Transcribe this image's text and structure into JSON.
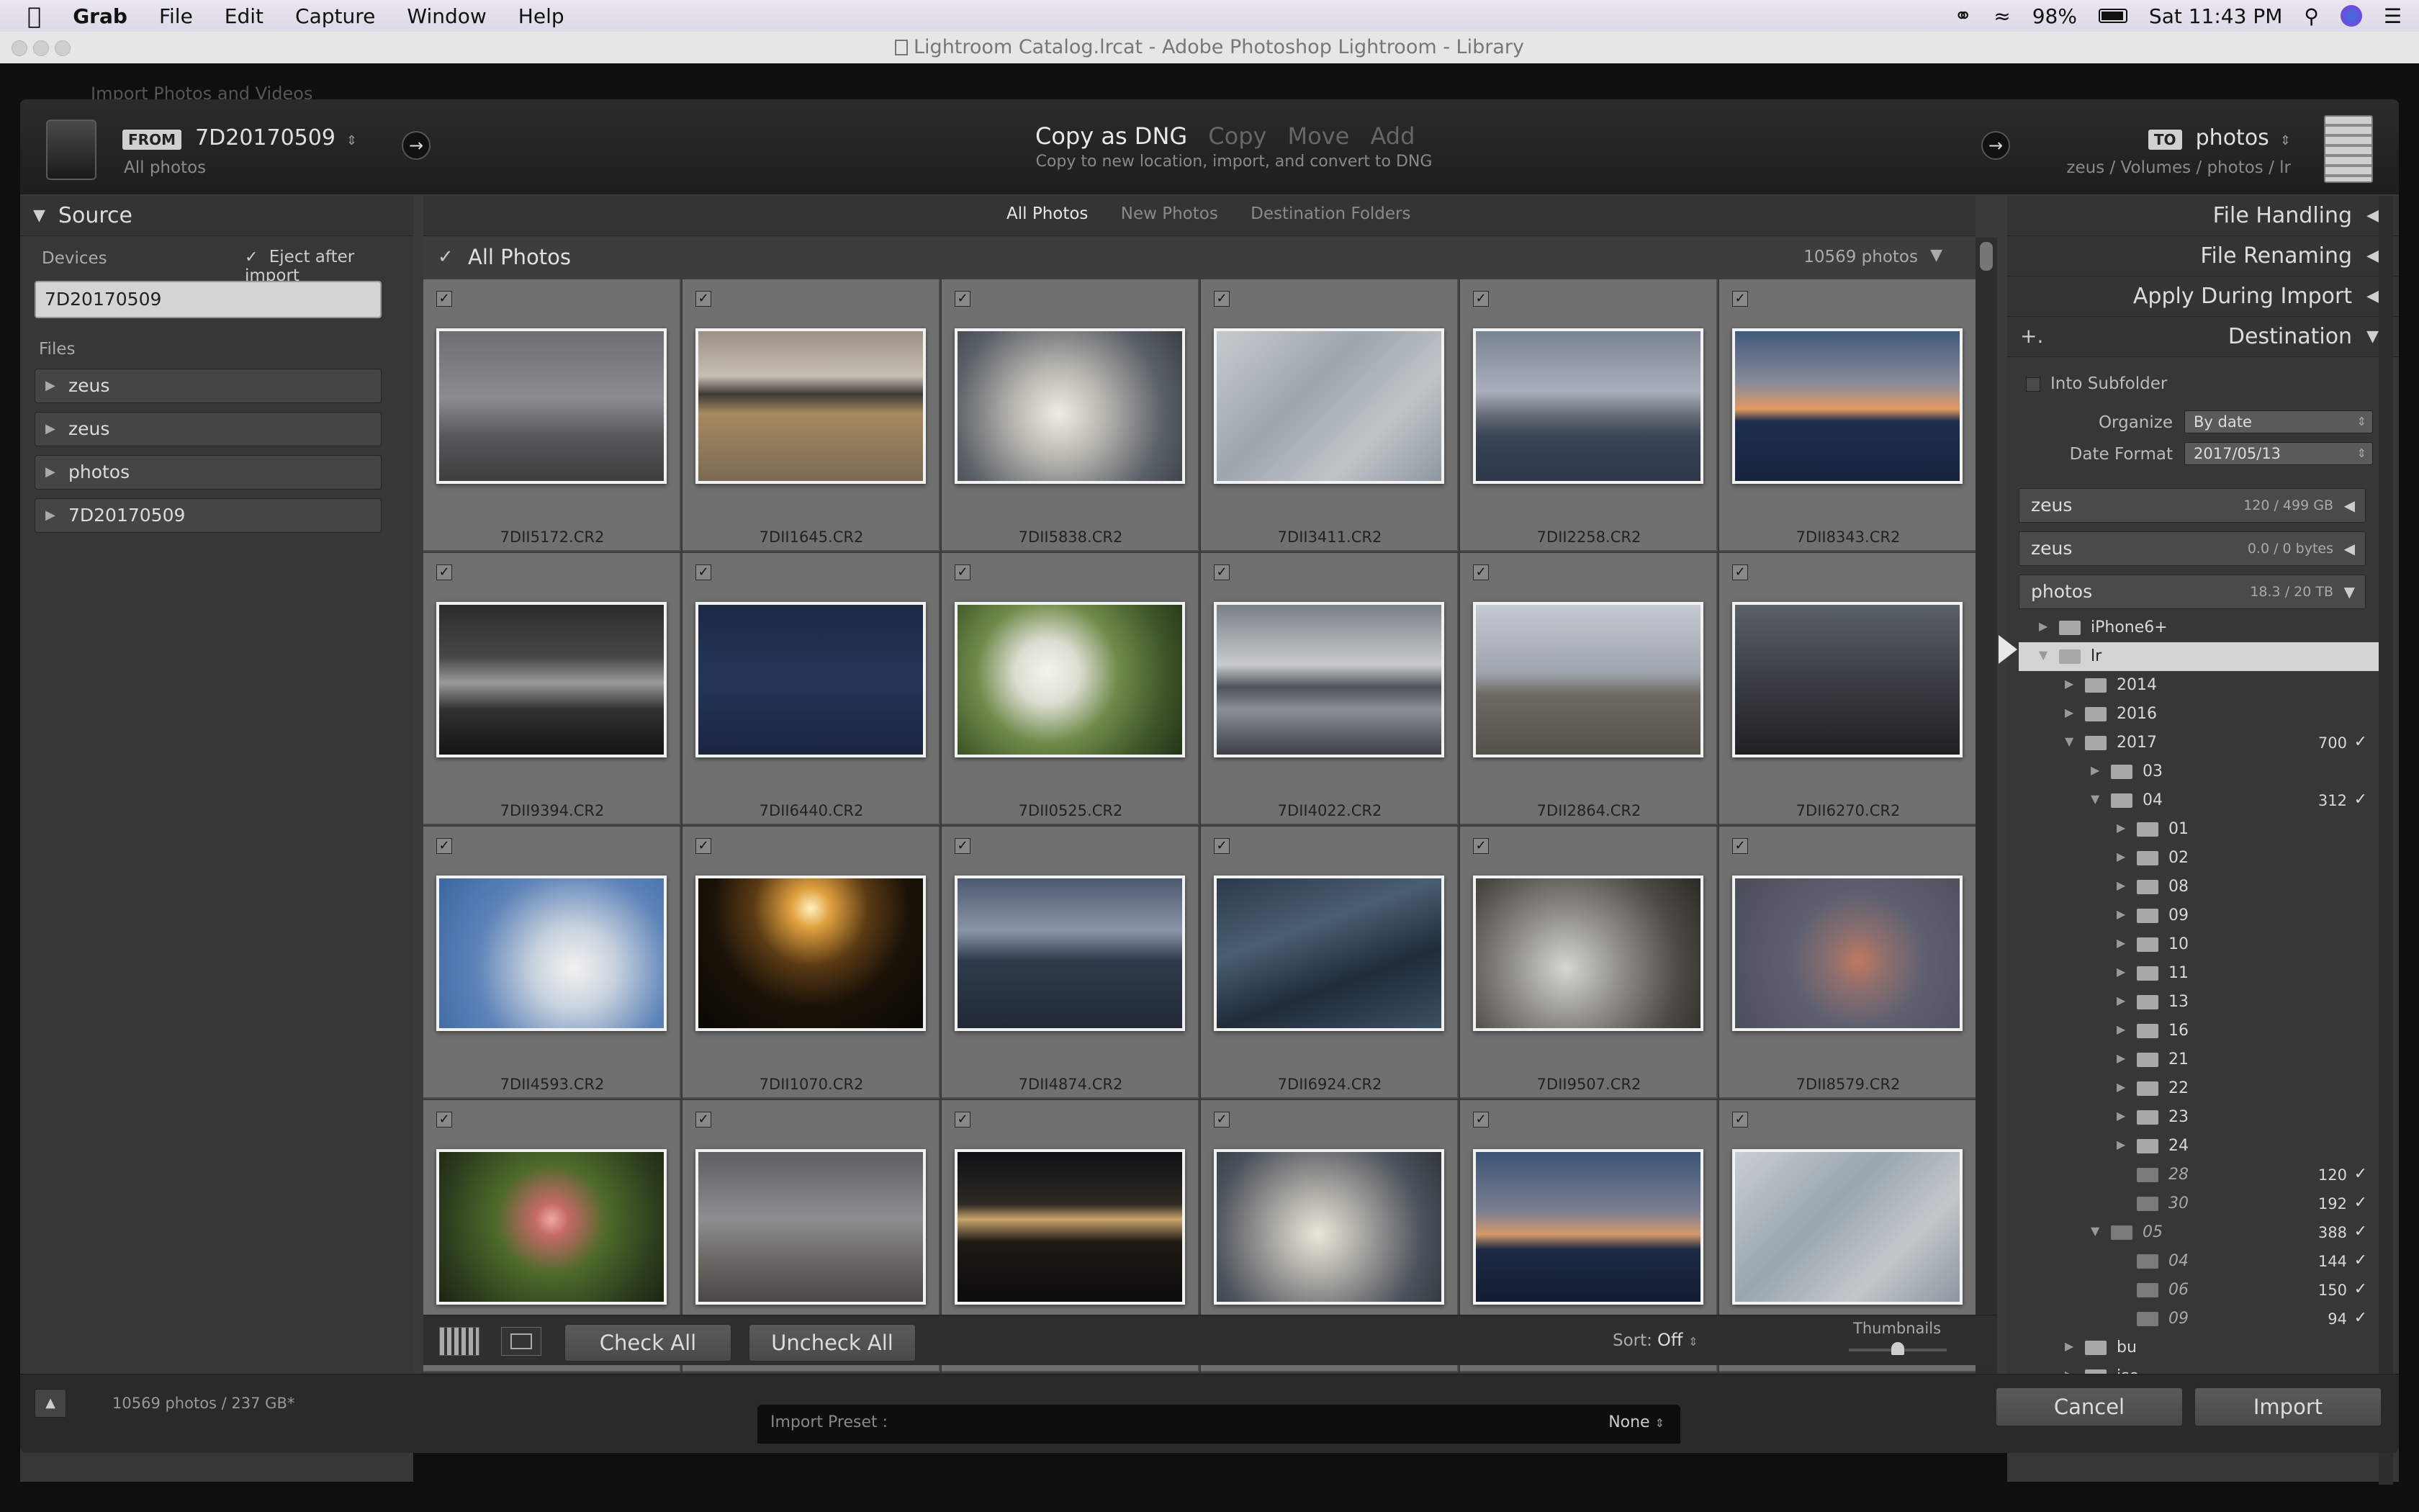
{
  "menubar": {
    "apple": "",
    "app": "Grab",
    "items": [
      "File",
      "Edit",
      "Capture",
      "Window",
      "Help"
    ],
    "battery": "98%",
    "clock": "Sat 11:43 PM"
  },
  "window_title": "Lightroom Catalog.lrcat - Adobe Photoshop Lightroom - Library",
  "behind_title": "Import Photos and Videos",
  "header": {
    "from_badge": "FROM",
    "from_name": "7D20170509",
    "from_sub": "All photos",
    "modes": [
      "Copy as DNG",
      "Copy",
      "Move",
      "Add"
    ],
    "mode_desc": "Copy to new location, import, and convert to DNG",
    "to_badge": "TO",
    "to_name": "photos",
    "to_path": "zeus / Volumes / photos / lr"
  },
  "source": {
    "title": "Source",
    "devices_label": "Devices",
    "eject_label": "Eject after import",
    "device": "7D20170509",
    "files_label": "Files",
    "items": [
      "zeus",
      "zeus",
      "photos",
      "7D20170509"
    ]
  },
  "tabs": [
    "All Photos",
    "New Photos",
    "Destination Folders"
  ],
  "grid_header": {
    "title": "All Photos",
    "count": "10569 photos"
  },
  "photos": [
    {
      "name": "7DII5172.CR2",
      "bg": "linear-gradient(#6c6e72 0%,#8a8c90 45%,#56585a 70%,#3e3e3e 100%)"
    },
    {
      "name": "7DII1645.CR2",
      "bg": "linear-gradient(#9a9088 0%,#c8bfb3 30%,#3c3a34 42%,#a58a60 55%,#7a6a54 100%)"
    },
    {
      "name": "7DII5838.CR2",
      "bg": "radial-gradient(circle at 45% 55%,#f0ece4 0%,#b9b7b0 30%,#5a6168 70%,#3b3f45 100%)"
    },
    {
      "name": "7DII3411.CR2",
      "bg": "linear-gradient(135deg,#c6cacf 0%,#9da6ad 40%,#bfc4c8 70%,#8e98a0 100%)"
    },
    {
      "name": "7DII2258.CR2",
      "bg": "linear-gradient(#7a8392 0%,#aab0bb 40%,#5f6670 58%,#3a4456 70%,#2d3748 100%)"
    },
    {
      "name": "7DII8343.CR2",
      "bg": "linear-gradient(#3f5a7c 0%,#8c8a9a 35%,#e29a62 52%,#1f2f4e 60%,#16233d 100%)"
    },
    {
      "name": "7DII9394.CR2",
      "bg": "linear-gradient(#2c2c2c 0%,#474747 35%,#9a9a9a 52%,#303030 70%,#151515 100%)"
    },
    {
      "name": "7DII6440.CR2",
      "bg": "linear-gradient(#1d2a44 0%,#26365a 50%,#1a2540 100%)"
    },
    {
      "name": "7DII0525.CR2",
      "bg": "radial-gradient(circle at 40% 45%,#f4f4ee 0%,#dcded2 20%,#6f8a4a 45%,#3e5628 75%,#233519 100%)"
    },
    {
      "name": "7DII4022.CR2",
      "bg": "linear-gradient(#7a7f86 0%,#c8ccd0 40%,#4d5358 55%,#8b9096 70%,#3c4046 100%)"
    },
    {
      "name": "7DII2864.CR2",
      "bg": "linear-gradient(#c4c9d2 0%,#9fa5ae 45%,#6e6a63 60%,#54504a 100%)"
    },
    {
      "name": "7DII6270.CR2",
      "bg": "linear-gradient(#5a6068 0%,#3a3e44 50%,#1e2024 100%)"
    },
    {
      "name": "7DII4593.CR2",
      "bg": "radial-gradient(circle at 60% 60%,#f2f2f0 0%,#c9d3df 25%,#5d83b8 60%,#3d66a0 100%)"
    },
    {
      "name": "7DII1070.CR2",
      "bg": "radial-gradient(circle at 50% 20%,#fff2c0 0%,#e0a040 12%,#5a3a14 35%,#1a1208 60%,#0a0804 100%)"
    },
    {
      "name": "7DII4874.CR2",
      "bg": "linear-gradient(#4c5a70 0%,#8a94a6 35%,#303a4a 55%,#222a38 100%)"
    },
    {
      "name": "7DII6924.CR2",
      "bg": "linear-gradient(160deg,#2b3a4a 0%,#4a5e72 35%,#1f2c3a 65%,#3c4f62 100%)"
    },
    {
      "name": "7DII9507.CR2",
      "bg": "radial-gradient(circle at 40% 60%,#d6d6d2 0%,#8d8c86 35%,#4c4a44 70%,#2c2a26 100%)"
    },
    {
      "name": "7DII8579.CR2",
      "bg": "radial-gradient(circle at 55% 55%,#c07860 0%,#8a6e6e 20%,#5e6070 45%,#4a4c58 100%)"
    },
    {
      "name": "",
      "bg": "radial-gradient(circle at 50% 45%,#f0a8a0 0%,#c46a66 12%,#4d6a2a 40%,#2e3e1e 75%,#1c2412 100%)"
    },
    {
      "name": "",
      "bg": "linear-gradient(#5d5f62 0%,#8c8e90 45%,#6c6a66 70%,#4a4846 100%)"
    },
    {
      "name": "",
      "bg": "linear-gradient(#0e1014 0%,#2e2a24 35%,#c9a46a 45%,#1e1a14 60%,#0c0c0c 100%)"
    },
    {
      "name": "",
      "bg": "radial-gradient(circle at 45% 55%,#ece6da 0%,#a9a8a2 30%,#4c535c 70%,#30353c 100%)"
    },
    {
      "name": "",
      "bg": "linear-gradient(#3a5474 0%,#7d7f92 40%,#d49a6a 55%,#1c2a44 65%,#121d32 100%)"
    },
    {
      "name": "",
      "bg": "linear-gradient(135deg,#c9ced3 0%,#9aa5ae 40%,#c2c7cb 70%,#8d96a0 100%)"
    }
  ],
  "toolbar": {
    "check_all": "Check All",
    "uncheck_all": "Uncheck All",
    "sort_label": "Sort:",
    "sort_value": "Off",
    "thumbnails_label": "Thumbnails",
    "thumb_level": 0.5
  },
  "right": {
    "sections": [
      "File Handling",
      "File Renaming",
      "Apply During Import",
      "Destination"
    ],
    "plus": "+.",
    "into_subfolder": "Into Subfolder",
    "organize_label": "Organize",
    "organize_value": "By date",
    "date_format_label": "Date Format",
    "date_format_value": "2017/05/13",
    "volumes": [
      {
        "name": "zeus",
        "info": "120 / 499 GB"
      },
      {
        "name": "zeus",
        "info": "0.0 / 0 bytes"
      },
      {
        "name": "photos",
        "info": "18.3 / 20 TB"
      }
    ],
    "tree": [
      {
        "label": "iPhone6+",
        "level": 1,
        "tw": "▶",
        "count": "",
        "check": false,
        "italic": false,
        "selected": false
      },
      {
        "label": "lr",
        "level": 1,
        "tw": "▼",
        "count": "",
        "check": false,
        "italic": false,
        "selected": true
      },
      {
        "label": "2014",
        "level": 2,
        "tw": "▶",
        "count": "",
        "check": false,
        "italic": false,
        "selected": false
      },
      {
        "label": "2016",
        "level": 2,
        "tw": "▶",
        "count": "",
        "check": false,
        "italic": false,
        "selected": false
      },
      {
        "label": "2017",
        "level": 2,
        "tw": "▼",
        "count": "700",
        "check": true,
        "italic": false,
        "selected": false
      },
      {
        "label": "03",
        "level": 3,
        "tw": "▶",
        "count": "",
        "check": false,
        "italic": false,
        "selected": false
      },
      {
        "label": "04",
        "level": 3,
        "tw": "▼",
        "count": "312",
        "check": true,
        "italic": false,
        "selected": false
      },
      {
        "label": "01",
        "level": 4,
        "tw": "▶",
        "count": "",
        "check": false,
        "italic": false,
        "selected": false
      },
      {
        "label": "02",
        "level": 4,
        "tw": "▶",
        "count": "",
        "check": false,
        "italic": false,
        "selected": false
      },
      {
        "label": "08",
        "level": 4,
        "tw": "▶",
        "count": "",
        "check": false,
        "italic": false,
        "selected": false
      },
      {
        "label": "09",
        "level": 4,
        "tw": "▶",
        "count": "",
        "check": false,
        "italic": false,
        "selected": false
      },
      {
        "label": "10",
        "level": 4,
        "tw": "▶",
        "count": "",
        "check": false,
        "italic": false,
        "selected": false
      },
      {
        "label": "11",
        "level": 4,
        "tw": "▶",
        "count": "",
        "check": false,
        "italic": false,
        "selected": false
      },
      {
        "label": "13",
        "level": 4,
        "tw": "▶",
        "count": "",
        "check": false,
        "italic": false,
        "selected": false
      },
      {
        "label": "16",
        "level": 4,
        "tw": "▶",
        "count": "",
        "check": false,
        "italic": false,
        "selected": false
      },
      {
        "label": "21",
        "level": 4,
        "tw": "▶",
        "count": "",
        "check": false,
        "italic": false,
        "selected": false
      },
      {
        "label": "22",
        "level": 4,
        "tw": "▶",
        "count": "",
        "check": false,
        "italic": false,
        "selected": false
      },
      {
        "label": "23",
        "level": 4,
        "tw": "▶",
        "count": "",
        "check": false,
        "italic": false,
        "selected": false
      },
      {
        "label": "24",
        "level": 4,
        "tw": "▶",
        "count": "",
        "check": false,
        "italic": false,
        "selected": false
      },
      {
        "label": "28",
        "level": 4,
        "tw": "",
        "count": "120",
        "check": true,
        "italic": true,
        "selected": false
      },
      {
        "label": "30",
        "level": 4,
        "tw": "",
        "count": "192",
        "check": true,
        "italic": true,
        "selected": false
      },
      {
        "label": "05",
        "level": 3,
        "tw": "▼",
        "count": "388",
        "check": true,
        "italic": true,
        "selected": false
      },
      {
        "label": "04",
        "level": 4,
        "tw": "",
        "count": "144",
        "check": true,
        "italic": true,
        "selected": false
      },
      {
        "label": "06",
        "level": 4,
        "tw": "",
        "count": "150",
        "check": true,
        "italic": true,
        "selected": false
      },
      {
        "label": "09",
        "level": 4,
        "tw": "",
        "count": "94",
        "check": true,
        "italic": true,
        "selected": false
      },
      {
        "label": "bu",
        "level": 2,
        "tw": "▶",
        "count": "",
        "check": false,
        "italic": false,
        "selected": false
      },
      {
        "label": "iso",
        "level": 2,
        "tw": "▶",
        "count": "",
        "check": false,
        "italic": false,
        "selected": false
      }
    ]
  },
  "bottom": {
    "status": "10569 photos / 237 GB*",
    "preset_label": "Import Preset :",
    "preset_value": "None",
    "cancel": "Cancel",
    "import": "Import"
  },
  "colors": {
    "grid_cell": "#707070",
    "panel": "#373737",
    "selected_row": "#d4d4d4"
  }
}
